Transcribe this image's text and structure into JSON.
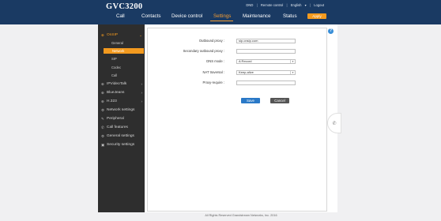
{
  "app": {
    "title": "GVC3200"
  },
  "top_links": {
    "dnd": "DND",
    "remote": "Remote control",
    "language": "English",
    "lang_arrow": "▾",
    "logout": "Logout",
    "sep": "|"
  },
  "nav": [
    {
      "label": "Call"
    },
    {
      "label": "Contacts"
    },
    {
      "label": "Device control"
    },
    {
      "label": "Settings"
    },
    {
      "label": "Maintenance"
    },
    {
      "label": "Status"
    }
  ],
  "apply_label": "Apply",
  "sidebar": {
    "sections": [
      {
        "label": "OnSIP",
        "icon": "⊕",
        "arrow": "⌄"
      },
      {
        "label": "IPVideoTalk",
        "icon": "⊕",
        "arrow": "›"
      },
      {
        "label": "BlueJeans",
        "icon": "⊕",
        "arrow": "›"
      },
      {
        "label": "H.323",
        "icon": "⊕",
        "arrow": "›"
      },
      {
        "label": "Network settings",
        "icon": "⚙"
      },
      {
        "label": "Peripheral",
        "icon": "✎"
      },
      {
        "label": "Call features",
        "icon": "✆"
      },
      {
        "label": "General settings",
        "icon": "⚙"
      },
      {
        "label": "Security settings",
        "icon": "▣"
      }
    ],
    "sub_items": [
      {
        "label": "General"
      },
      {
        "label": "Network"
      },
      {
        "label": "SIP"
      },
      {
        "label": "Codec"
      },
      {
        "label": "Call"
      }
    ]
  },
  "form": {
    "outbound_proxy": {
      "label": "Outbound proxy :",
      "value": "sip.onsip.com"
    },
    "secondary_outbound_proxy": {
      "label": "Secondary outbound proxy :",
      "value": ""
    },
    "dns_mode": {
      "label": "DNS mode :",
      "value": "A Record"
    },
    "nat_traversal": {
      "label": "NAT traversal :",
      "value": "Keep-alive"
    },
    "proxy_require": {
      "label": "Proxy-require :",
      "value": ""
    },
    "save_label": "Save",
    "cancel_label": "Cancel"
  },
  "icons": {
    "help": "?",
    "phone": "✆",
    "dropdown": "▾"
  },
  "footer": {
    "text": "All Rights Reserved Grandstream Networks, Inc. 2016"
  },
  "colors": {
    "header": "#1a3a63",
    "accent": "#f39a1f",
    "sidebar": "#2e2e2e",
    "primary_button": "#2a79c7"
  }
}
